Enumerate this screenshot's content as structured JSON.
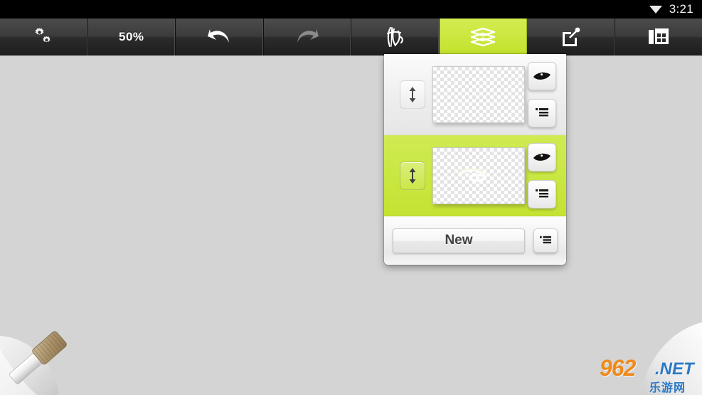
{
  "statusbar": {
    "wifi_icon": "wifi-icon",
    "time": "3:21"
  },
  "toolbar": {
    "buttons": [
      {
        "name": "settings-button",
        "icon": "gears-icon",
        "label": "",
        "state": "normal"
      },
      {
        "name": "zoom-level-button",
        "icon": "",
        "label": "50%",
        "state": "normal"
      },
      {
        "name": "undo-button",
        "icon": "undo-arrow-icon",
        "label": "",
        "state": "normal"
      },
      {
        "name": "redo-button",
        "icon": "redo-arrow-icon",
        "label": "",
        "state": "disabled"
      },
      {
        "name": "brush-settings-button",
        "icon": "calligraphy-brush-icon",
        "label": "",
        "state": "normal"
      },
      {
        "name": "layers-button",
        "icon": "layers-icon",
        "label": "",
        "state": "active"
      },
      {
        "name": "share-button",
        "icon": "share-export-icon",
        "label": "",
        "state": "normal"
      },
      {
        "name": "gallery-button",
        "icon": "gallery-folder-icon",
        "label": "",
        "state": "normal"
      }
    ]
  },
  "layers_panel": {
    "rows": [
      {
        "name": "layer-row-1",
        "selected": false,
        "handle_icon": "reorder-updown-icon",
        "thumbnail": "empty-transparent-layer",
        "visibility_icon": "eye-icon",
        "menu_icon": "layer-menu-icon"
      },
      {
        "name": "layer-row-2",
        "selected": true,
        "handle_icon": "reorder-updown-icon",
        "thumbnail": "brush-stroke-layer",
        "visibility_icon": "eye-icon",
        "menu_icon": "layer-menu-icon"
      }
    ],
    "footer": {
      "new_label": "New",
      "menu_icon": "layers-menu-icon"
    }
  },
  "canvas": {
    "brush_tool_icon": "brush-tool-icon",
    "page_corner_icon": "page-curl-corner-icon"
  },
  "watermark": {
    "number": "962",
    "domain": ".NET",
    "chinese": "乐游网"
  },
  "colors": {
    "accent_green": "#c9e741",
    "toolbar_dark": "#333333",
    "canvas_gray": "#d4d4d4",
    "statusbar_black": "#000000",
    "watermark_orange": "#f08a1b",
    "watermark_blue": "#2b79c4"
  }
}
